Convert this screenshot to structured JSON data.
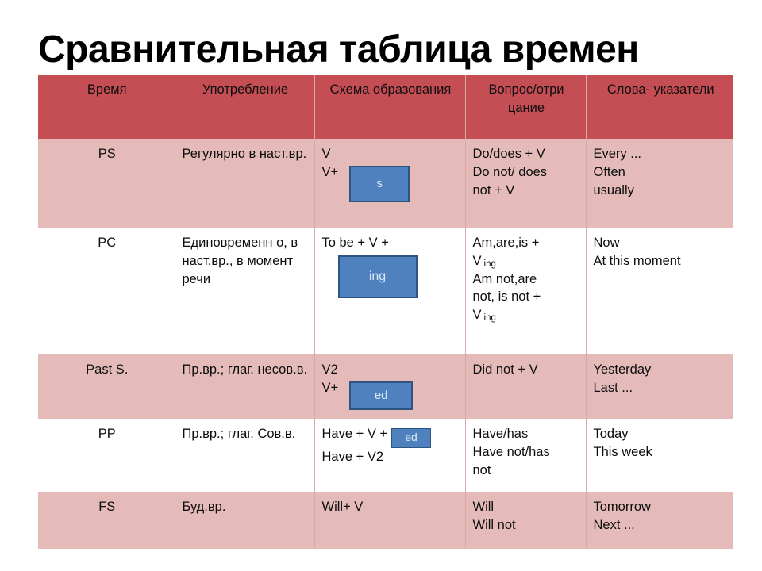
{
  "title": "Сравнительная таблица времен",
  "colors": {
    "header_bg": "#C44E54",
    "shaded_row_bg": "#E5BBBA",
    "plain_row_bg": "#FFFFFF",
    "chip_bg": "#4E81BD",
    "chip_border": "#2E5484",
    "chip_text": "#DCE9F7",
    "text": "#0D0D0D",
    "divider": "#D9A9A9"
  },
  "table": {
    "headers": [
      "Время",
      "Употребление",
      "Схема\nобразования",
      "Вопрос/отри\nцание",
      "Слова-\nуказатели"
    ],
    "rows": [
      {
        "tense": "PS",
        "usage": "Регулярно в\nнаст.вр.",
        "formation_lines": [
          "V",
          "V+"
        ],
        "formation_chip": "s",
        "question_negation": [
          "Do/does + V",
          "Do not/ does",
          "not + V"
        ],
        "markers": [
          "Every ...",
          "Often",
          "usually"
        ]
      },
      {
        "tense": "PC",
        "usage": "Единовременн\nо, в наст.вр., в\nмомент речи",
        "formation_lines": [
          "To be + V +"
        ],
        "formation_chip": "ing",
        "question_negation": [
          "Am,are,is +",
          "V|ing",
          "Am not,are",
          "not, is not +",
          "V|ing"
        ],
        "markers": [
          "Now",
          "At this moment"
        ]
      },
      {
        "tense": "Past S.",
        "usage": "Пр.вр.; глаг.\nнесов.в.",
        "formation_lines": [
          "V2",
          "V+"
        ],
        "formation_chip": "ed",
        "question_negation": [
          "Did not + V"
        ],
        "markers": [
          "Yesterday",
          "Last ..."
        ]
      },
      {
        "tense": "PP",
        "usage": "Пр.вр.; глаг.\nСов.в.",
        "formation_lines": [
          "Have + V +",
          "Have + V2"
        ],
        "formation_chip": "ed",
        "question_negation": [
          "Have/has",
          "Have not/has",
          "not"
        ],
        "markers": [
          "Today",
          "This week"
        ]
      },
      {
        "tense": "FS",
        "usage": "Буд.вр.",
        "formation_lines": [
          "Will+ V"
        ],
        "formation_chip": null,
        "question_negation": [
          "Will",
          "Will not"
        ],
        "markers": [
          "Tomorrow",
          "Next ..."
        ]
      }
    ]
  }
}
